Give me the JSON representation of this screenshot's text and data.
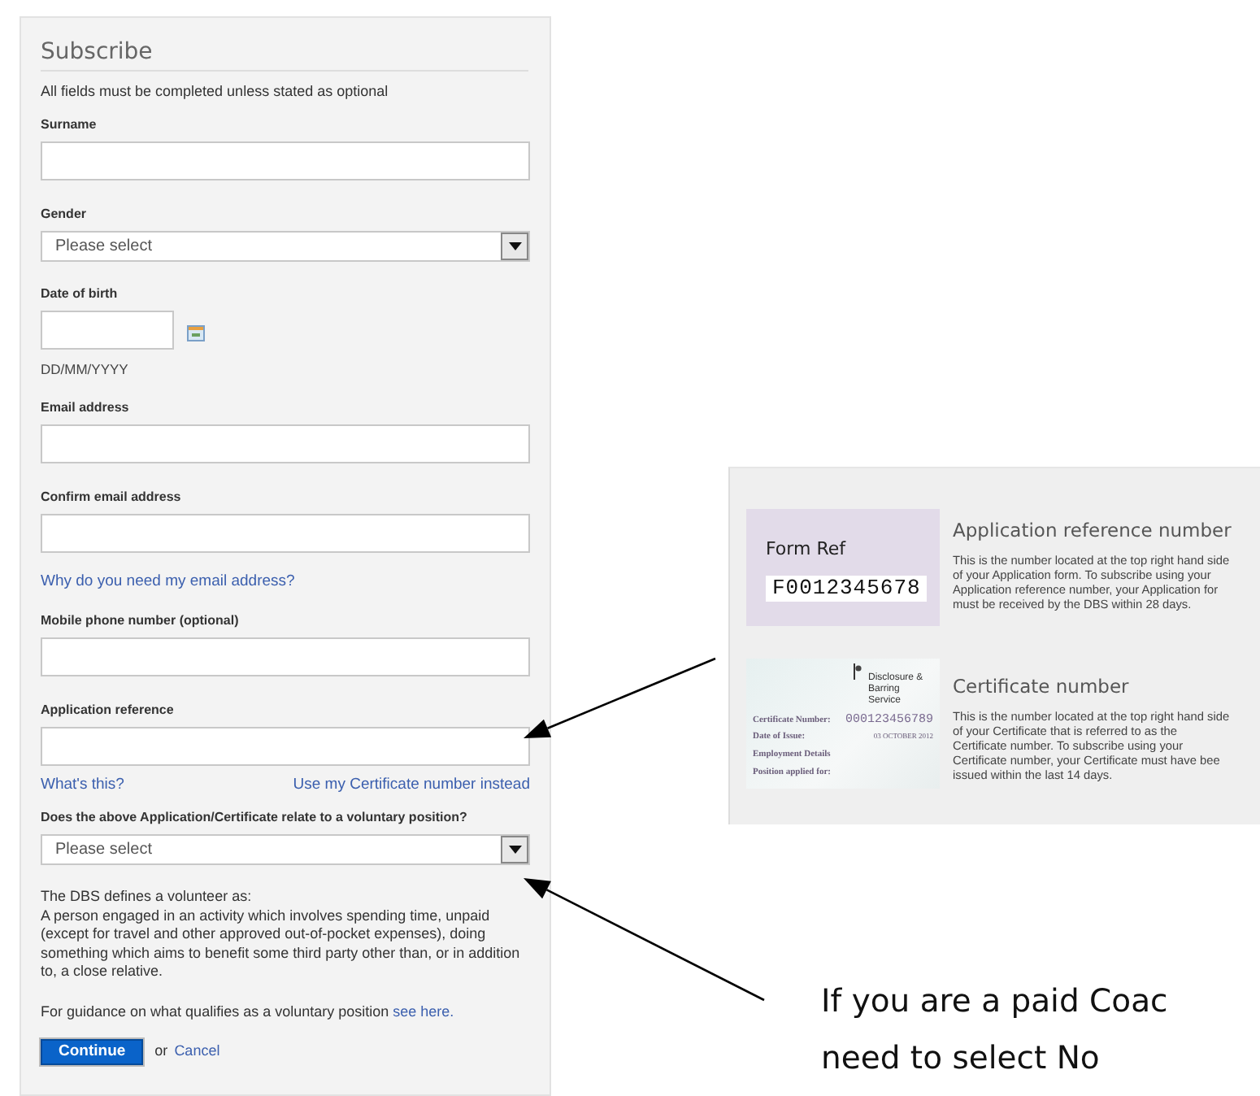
{
  "form": {
    "title": "Subscribe",
    "intro": "All fields must be completed unless stated as optional",
    "items": [
      {
        "kind": "text",
        "label": "Surname"
      },
      {
        "kind": "select",
        "label": "Gender",
        "value": "Please select"
      },
      {
        "kind": "date",
        "label": "Date of birth",
        "hint": "DD/MM/YYYY"
      },
      {
        "kind": "text",
        "label": "Email address"
      },
      {
        "kind": "text",
        "label": "Confirm email address"
      },
      {
        "kind": "link",
        "text": "Why do you need my email address?"
      },
      {
        "kind": "text",
        "label": "Mobile phone number (optional)"
      },
      {
        "kind": "text",
        "label": "Application reference"
      },
      {
        "kind": "links",
        "left": "What's this?",
        "right": "Use my Certificate number instead"
      },
      {
        "kind": "select",
        "label": "Does the above Application/Certificate relate to a voluntary position?",
        "value": "Please select"
      },
      {
        "kind": "note",
        "heading": "The DBS defines a volunteer as:",
        "text": "A person engaged in an activity which involves spending time, unpaid (except for travel and other approved out-of-pocket expenses), doing something which aims to benefit some third party other than, or in addition to, a close relative."
      },
      {
        "kind": "guidance",
        "text": "For guidance on what qualifies as a voluntary position ",
        "link": "see here."
      }
    ],
    "actions": {
      "submit": "Continue",
      "or": "or",
      "cancel": "Cancel"
    }
  },
  "help": {
    "cards": [
      {
        "kind": "form_ref",
        "label": "Form Ref",
        "ref": "F0012345678",
        "title": "Application reference number",
        "lines": [
          "This is the number located at the top right hand side",
          "of your Application form. To subscribe using your",
          "Application reference number, your Application for",
          "must be received by the DBS within 28 days."
        ]
      },
      {
        "kind": "certificate",
        "org": "Disclosure & Barring Service",
        "rows": [
          {
            "label": "Certificate Number:",
            "value": "000123456789"
          },
          {
            "label": "Date of Issue:",
            "value": "03 OCTOBER 2012"
          },
          {
            "label": "Employment Details",
            "value": ""
          },
          {
            "label": "Position applied for:",
            "value": ""
          }
        ],
        "title": "Certificate number",
        "lines": [
          "This is the number located at the top right hand side",
          "of your Certificate that is referred to as the",
          "Certificate number. To subscribe using your",
          "Certificate number, your Certificate must have bee",
          "issued within the last 14 days."
        ]
      }
    ]
  },
  "annotation": {
    "lines": [
      "If you are a paid Coac",
      "need to select No"
    ]
  }
}
